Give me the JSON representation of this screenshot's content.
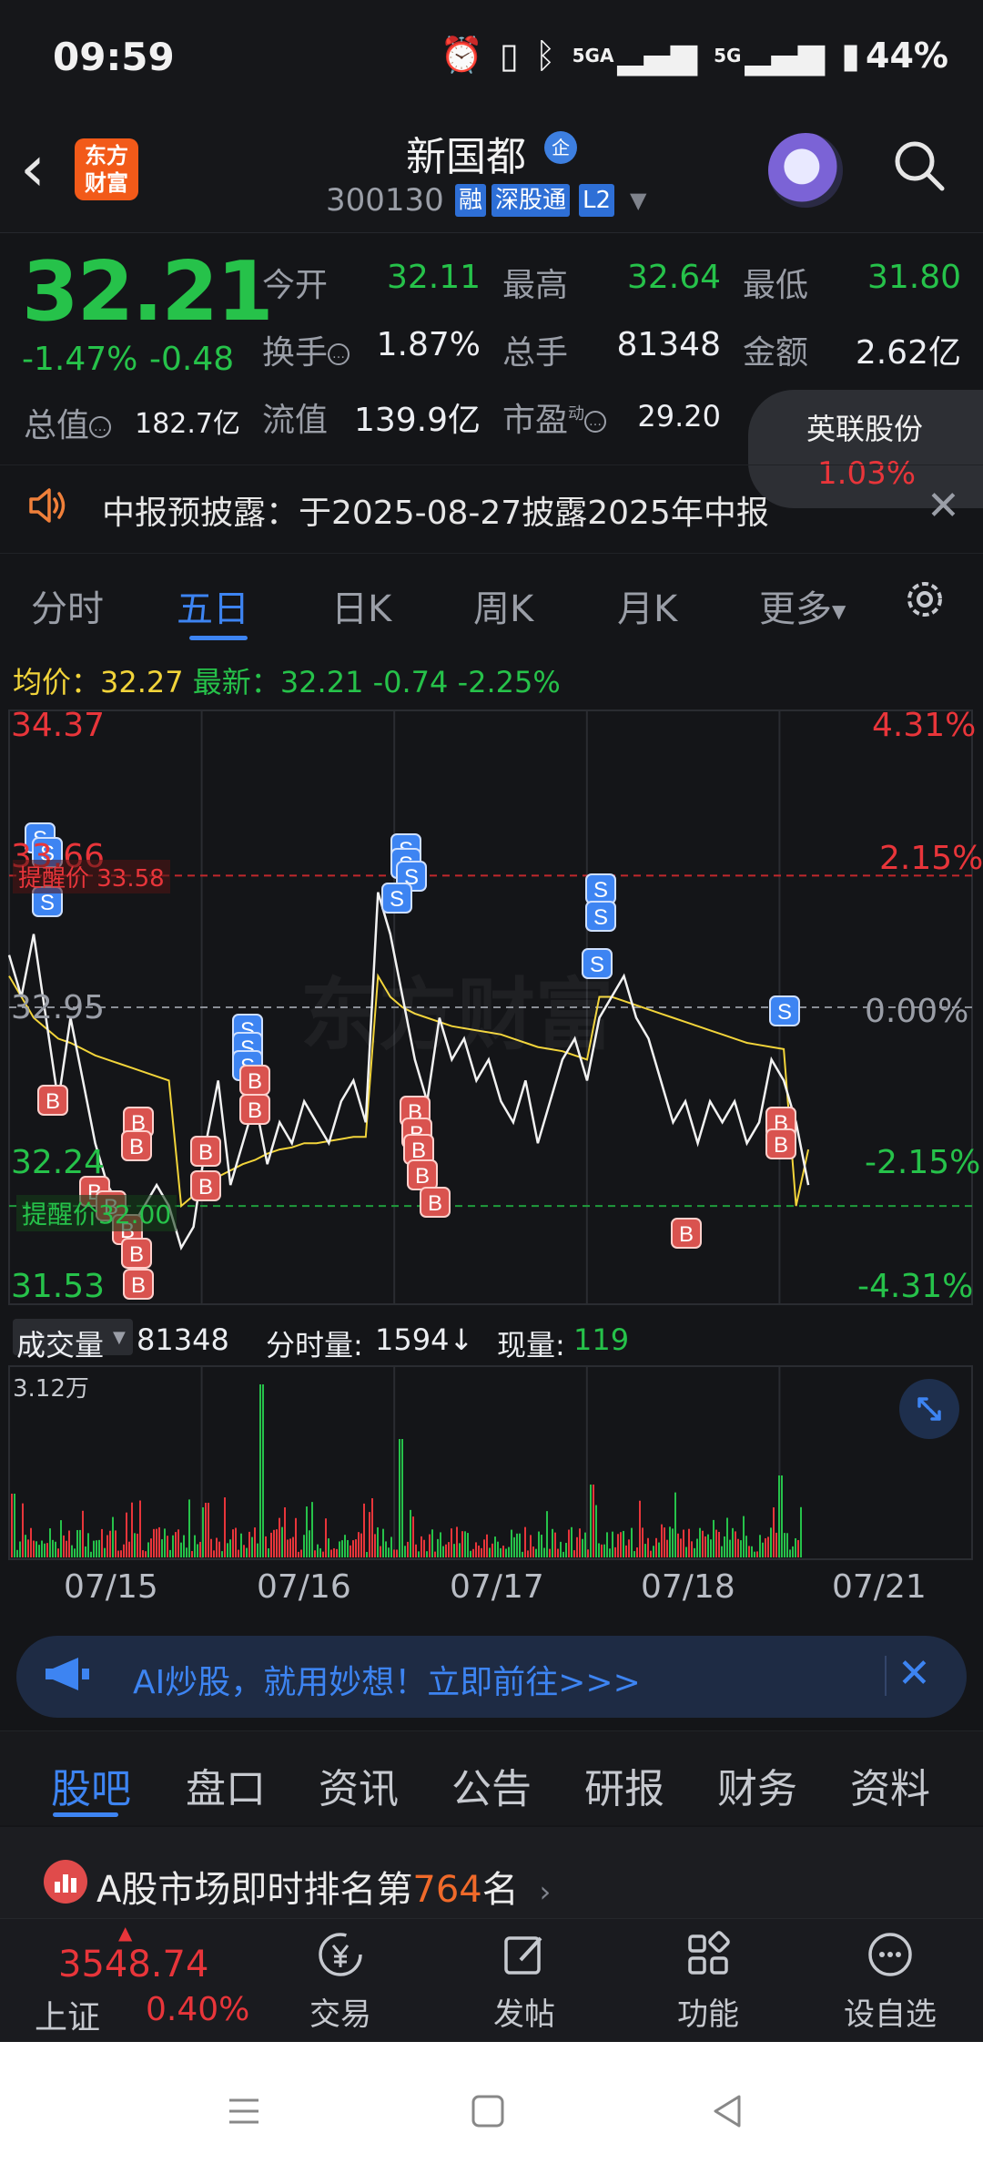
{
  "status_bar": {
    "time": "09:59",
    "network": "5GA",
    "network2": "5G",
    "battery": "44%"
  },
  "header": {
    "app_logo": "东方\n财富",
    "logo_line1": "东方",
    "logo_line2": "财富",
    "stock_name": "新国都",
    "name_badge": "企",
    "stock_code": "300130",
    "tags": [
      "融",
      "深股通",
      "L2"
    ]
  },
  "quote": {
    "price": "32.21",
    "change_pct": "-1.47%",
    "change_abs": "-0.48",
    "open_label": "今开",
    "open": "32.11",
    "high_label": "最高",
    "high": "32.64",
    "low_label": "最低",
    "low": "31.80",
    "turnover_label": "换手",
    "turnover": "1.87%",
    "volume_label": "总手",
    "volume": "81348",
    "amount_label": "金额",
    "amount": "2.62亿",
    "mktcap_label": "总值",
    "mktcap": "182.7亿",
    "float_label": "流值",
    "float_cap": "139.9亿",
    "pe_label": "市盈",
    "pe_sup": "动",
    "pe": "29.20"
  },
  "floating_card": {
    "name": "英联股份",
    "pct": "1.03%"
  },
  "notice": {
    "text": "中报预披露：于2025-08-27披露2025年中报"
  },
  "chart_tabs": [
    "分时",
    "五日",
    "日K",
    "周K",
    "月K",
    "更多"
  ],
  "active_chart_tab": 1,
  "chart_info": {
    "avg_label": "均价：",
    "avg": "32.27",
    "latest_label": "最新：",
    "latest": "32.21",
    "latest_chg": "-0.74",
    "latest_pct": "-2.25%"
  },
  "chart_labels": {
    "y_left": [
      "34.37",
      "33.66",
      "32.95",
      "32.24",
      "31.53"
    ],
    "y_right": [
      "4.31%",
      "2.15%",
      "0.00%",
      "-2.15%",
      "-4.31%"
    ],
    "alert_high": "提醒价 33.58",
    "alert_low": "提醒价32.00",
    "watermark": "东方财富"
  },
  "chart_data": {
    "type": "line",
    "days": [
      "07/15",
      "07/16",
      "07/17",
      "07/18",
      "07/21"
    ],
    "ylim": [
      31.53,
      34.37
    ],
    "y_right_ticks": [
      "4.31%",
      "2.15%",
      "0.00%",
      "-2.15%",
      "-4.31%"
    ],
    "reference_price": "32.95",
    "alert_prices": [
      33.58,
      32.0
    ],
    "series": [
      {
        "name": "最新",
        "values": [
          33.2,
          33.0,
          33.3,
          32.9,
          32.5,
          32.9,
          32.6,
          32.3,
          32.1,
          32.0,
          31.9,
          32.0,
          32.1,
          32.0,
          31.8,
          31.9,
          32.3,
          32.6,
          32.1,
          32.3,
          32.5,
          32.2,
          32.4,
          32.3,
          32.5,
          32.4,
          32.3,
          32.5,
          32.6,
          32.4,
          33.5,
          33.3,
          33.0,
          32.7,
          32.5,
          32.9,
          32.7,
          32.8,
          32.6,
          32.7,
          32.5,
          32.4,
          32.6,
          32.3,
          32.5,
          32.7,
          32.8,
          32.6,
          32.9,
          33.0,
          33.1,
          32.9,
          32.8,
          32.6,
          32.4,
          32.5,
          32.3,
          32.5,
          32.4,
          32.5,
          32.3,
          32.4,
          32.7,
          32.6,
          32.4,
          32.1
        ]
      },
      {
        "name": "均价",
        "values": [
          33.1,
          33.0,
          32.9,
          32.85,
          32.8,
          32.78,
          32.75,
          32.72,
          32.7,
          32.68,
          32.66,
          32.64,
          32.62,
          32.6,
          32.0,
          32.05,
          32.1,
          32.14,
          32.17,
          32.2,
          32.22,
          32.25,
          32.27,
          32.28,
          32.3,
          32.3,
          32.31,
          32.32,
          32.33,
          32.33,
          33.1,
          33.0,
          32.95,
          32.92,
          32.9,
          32.88,
          32.86,
          32.85,
          32.84,
          32.83,
          32.82,
          32.8,
          32.78,
          32.76,
          32.75,
          32.74,
          32.72,
          32.7,
          33.0,
          33.0,
          32.98,
          32.96,
          32.94,
          32.92,
          32.9,
          32.88,
          32.86,
          32.84,
          32.82,
          32.8,
          32.78,
          32.77,
          32.76,
          32.75,
          32.0,
          32.27
        ]
      }
    ],
    "trade_marks": {
      "S": 16,
      "B": 27
    }
  },
  "volume_panel": {
    "label": "成交量",
    "total": "81348",
    "fs_label": "分时量:",
    "fs_value": "1594↓",
    "now_label": "现量:",
    "now_value": "119",
    "max_label": "3.12万"
  },
  "dates": [
    "07/15",
    "07/16",
    "07/17",
    "07/18",
    "07/21"
  ],
  "ai_banner": {
    "text": "AI炒股，就用妙想！立即前往>>>"
  },
  "bottom_tabs": [
    "股吧",
    "盘口",
    "资讯",
    "公告",
    "研报",
    "财务",
    "资料"
  ],
  "rank": {
    "prefix": "A股市场即时排名第",
    "num": "764",
    "suffix": "名"
  },
  "index": {
    "value": "3548.74",
    "name": "上证",
    "pct": "0.40%"
  },
  "nav": [
    "交易",
    "发帖",
    "功能",
    "设自选"
  ],
  "colors": {
    "up": "#e8353a",
    "down": "#26c24a",
    "accent": "#3d84f2",
    "avg": "#f2d43a"
  }
}
